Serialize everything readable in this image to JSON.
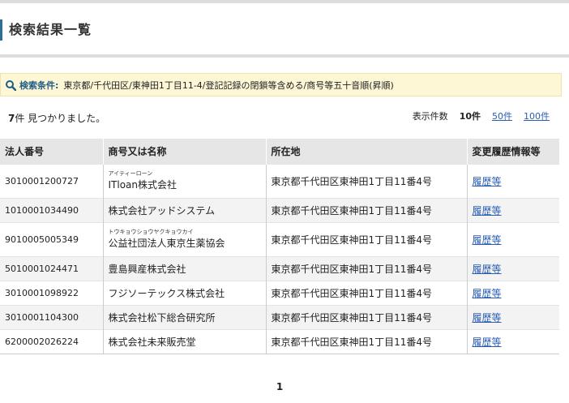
{
  "page": {
    "title": "検索結果一覧"
  },
  "search": {
    "label": "検索条件:",
    "conditions": "東京都/千代田区/東神田1丁目11-4/登記記録の閉鎖等含める/商号等五十音順(昇順)"
  },
  "results": {
    "count": "7",
    "count_suffix": "件 見つかりました。",
    "per_page_label": "表示件数",
    "per_page_options": [
      "10件",
      "50件",
      "100件"
    ],
    "per_page_selected": "10件"
  },
  "table": {
    "headers": [
      "法人番号",
      "商号又は名称",
      "所在地",
      "変更履歴情報等"
    ],
    "rows": [
      {
        "number": "3010001200727",
        "kana": "アイティーローン",
        "name": "ITloan株式会社",
        "address": "東京都千代田区東神田1丁目11番4号",
        "history": "履歴等"
      },
      {
        "number": "1010001034490",
        "kana": "",
        "name": "株式会社アッドシステム",
        "address": "東京都千代田区東神田1丁目11番4号",
        "history": "履歴等"
      },
      {
        "number": "9010005005349",
        "kana": "トウキョウショウヤクキョウカイ",
        "name": "公益社団法人東京生薬協会",
        "address": "東京都千代田区東神田1丁目11番4号",
        "history": "履歴等"
      },
      {
        "number": "5010001024471",
        "kana": "",
        "name": "豊島興産株式会社",
        "address": "東京都千代田区東神田1丁目11番4号",
        "history": "履歴等"
      },
      {
        "number": "3010001098922",
        "kana": "",
        "name": "フジソーテックス株式会社",
        "address": "東京都千代田区東神田1丁目11番4号",
        "history": "履歴等"
      },
      {
        "number": "3010001104300",
        "kana": "",
        "name": "株式会社松下総合研究所",
        "address": "東京都千代田区東神田1丁目11番4号",
        "history": "履歴等"
      },
      {
        "number": "6200002026224",
        "kana": "",
        "name": "株式会社未来販売堂",
        "address": "東京都千代田区東神田1丁目11番4号",
        "history": "履歴等"
      }
    ]
  },
  "pagination": {
    "current": "1"
  },
  "colors": {
    "accent": "#2c6e96",
    "link": "#2a5db0",
    "condition_bg": "#fdf7d6"
  },
  "icons": {
    "search": "search-icon"
  }
}
